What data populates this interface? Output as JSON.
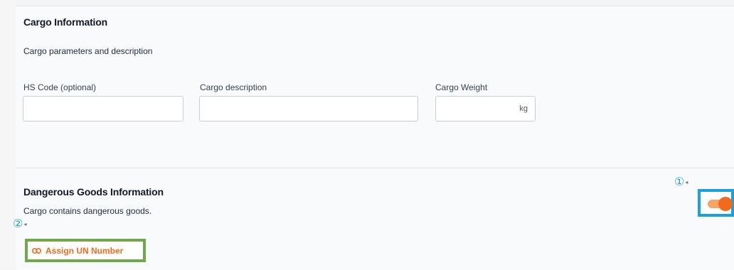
{
  "cargo": {
    "title": "Cargo Information",
    "subtitle": "Cargo parameters and description",
    "hs_code": {
      "label": "HS Code (optional)",
      "value": "",
      "placeholder": ""
    },
    "description": {
      "label": "Cargo description",
      "value": "",
      "placeholder": ""
    },
    "weight": {
      "label": "Cargo Weight",
      "value": "",
      "unit": "kg"
    }
  },
  "dangerous": {
    "title": "Dangerous Goods Information",
    "subtitle": "Cargo contains dangerous goods.",
    "toggle_on": true,
    "assign_label": "Assign UN Number",
    "assign_icon": "link-icon"
  },
  "annotations": {
    "callout_1": "①",
    "callout_2": "②"
  },
  "colors": {
    "accent": "#f26a1b",
    "toggle_track": "#f7a46b",
    "highlight_blue": "#1aa1de",
    "highlight_green": "#6fa94a",
    "callout": "#2aa3b8"
  }
}
